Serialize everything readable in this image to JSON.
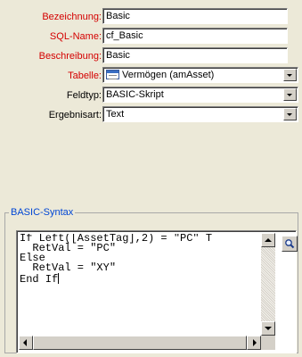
{
  "form": {
    "fields": [
      {
        "label": "Bezeichnung:",
        "value": "Basic"
      },
      {
        "label": "SQL-Name:",
        "value": "cf_Basic"
      },
      {
        "label": "Beschreibung:",
        "value": "Basic"
      },
      {
        "label": "Tabelle:",
        "value": "Vermögen (amAsset)",
        "icon": "table-icon"
      },
      {
        "label": "Feldtyp:",
        "value": "BASIC-Skript"
      },
      {
        "label": "Ergebnisart:",
        "value": "Text"
      }
    ]
  },
  "basic_syntax": {
    "title": "BASIC-Syntax",
    "code_lines": [
      "If Left([AssetTag],2) = \"PC\" T",
      "  RetVal = \"PC\"",
      "Else",
      "  RetVal = \"XY\"",
      "End If"
    ]
  },
  "colors": {
    "required_label": "#d40000",
    "group_title": "#0046d5",
    "dialog_bg": "#ece9d8"
  },
  "icons": {
    "zoom": "magnifier-icon",
    "table": "table-icon"
  }
}
